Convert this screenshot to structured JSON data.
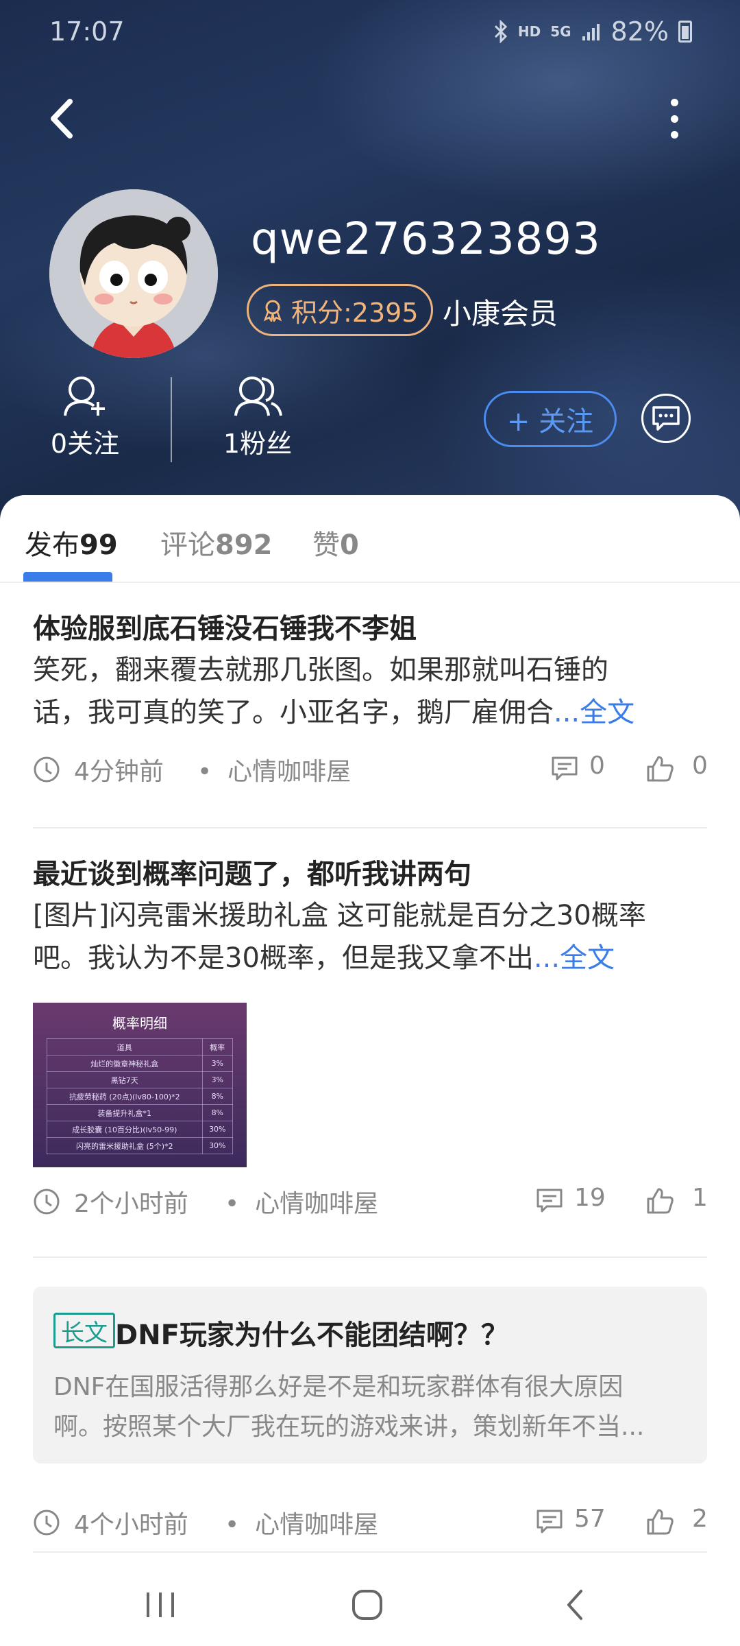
{
  "status_bar": {
    "time": "17:07",
    "network": "HD",
    "signal": "5G",
    "battery": "82%"
  },
  "profile": {
    "username": "qwe276323893",
    "points": "积分:2395",
    "member_level": "小康会员",
    "following": "0关注",
    "fans": "1粉丝",
    "follow_button": "+ 关注"
  },
  "tabs": [
    {
      "label": "发布",
      "count": "99"
    },
    {
      "label": "评论",
      "count": "892"
    },
    {
      "label": "赞",
      "count": "0"
    }
  ],
  "posts": [
    {
      "title": "体验服到底石锤没石锤我不李姐",
      "excerpt_line1": "笑死，翻来覆去就那几张图。如果那就叫石锤的",
      "excerpt_line2": "话，我可真的笑了。小亚名字，鹅厂雇佣合",
      "read_more": "...全文",
      "time": "4分钟前",
      "source": "心情咖啡屋",
      "comments": "0",
      "likes": "0"
    },
    {
      "title": "最近谈到概率问题了，都听我讲两句",
      "excerpt_line1": "[图片]闪亮雷米援助礼盒 这可能就是百分之30概率",
      "excerpt_line2": "吧。我认为不是30概率，但是我又拿不出",
      "read_more": "...全文",
      "time": "2个小时前",
      "source": "心情咖啡屋",
      "comments": "19",
      "likes": "1",
      "thumbnail": {
        "title": "概率明细",
        "rows": [
          [
            "道具",
            "概率"
          ],
          [
            "灿烂的徽章神秘礼盒",
            "3%"
          ],
          [
            "黑钻7天",
            "3%"
          ],
          [
            "抗疲劳秘药 (20点)(lv80-100)*2",
            "8%"
          ],
          [
            "装备提升礼盒*1",
            "8%"
          ],
          [
            "成长胶囊 (10百分比)(lv50-99)",
            "30%"
          ],
          [
            "闪亮的雷米援助礼盒 (5个)*2",
            "30%"
          ]
        ]
      }
    },
    {
      "tag": "长文",
      "title": "DNF玩家为什么不能团结啊？？",
      "excerpt_line1": "DNF在国服活得那么好是不是和玩家群体有很大原因",
      "excerpt_line2": "啊。按照某个大厂我在玩的游戏来讲，策划新年不当...",
      "time": "4个小时前",
      "source": "心情咖啡屋",
      "comments": "57",
      "likes": "2"
    }
  ],
  "colors": {
    "accent_blue": "#3a7ce8",
    "points_orange": "#f2b478",
    "long_tag_teal": "#1a9c8e",
    "header_navy": "#1c2c4f"
  },
  "icons": [
    "back-icon",
    "more-icon",
    "add-user-icon",
    "fans-icon",
    "message-icon",
    "clock-icon",
    "comment-icon",
    "like-icon",
    "medal-icon"
  ]
}
